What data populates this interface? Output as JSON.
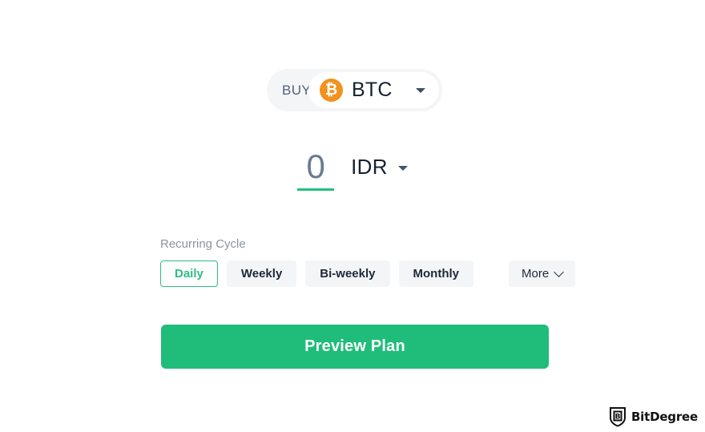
{
  "buy_selector": {
    "action_label": "BUY",
    "coin_icon": "bitcoin-icon",
    "coin_glyph": "₿",
    "coin_symbol": "BTC",
    "dropdown_icon": "caret-down-icon",
    "accent_color": "#f1921e",
    "pill_bg": "#f4f5f7"
  },
  "amount": {
    "value": "0",
    "placeholder": "0",
    "underline_color": "#22c07d",
    "currency": "IDR",
    "currency_dropdown_icon": "caret-down-icon"
  },
  "recurring_cycle": {
    "label": "Recurring Cycle",
    "selected": "Daily",
    "selected_color": "#2ebd85",
    "options": [
      {
        "label": "Daily",
        "selected": true
      },
      {
        "label": "Weekly",
        "selected": false
      },
      {
        "label": "Bi-weekly",
        "selected": false
      },
      {
        "label": "Monthly",
        "selected": false
      }
    ],
    "more": {
      "label": "More",
      "icon": "chevron-down-icon"
    }
  },
  "submit": {
    "label": "Preview Plan",
    "color": "#1fbd79"
  },
  "watermark": {
    "icon": "bitdegree-shield-logo",
    "text": "BitDegree"
  }
}
